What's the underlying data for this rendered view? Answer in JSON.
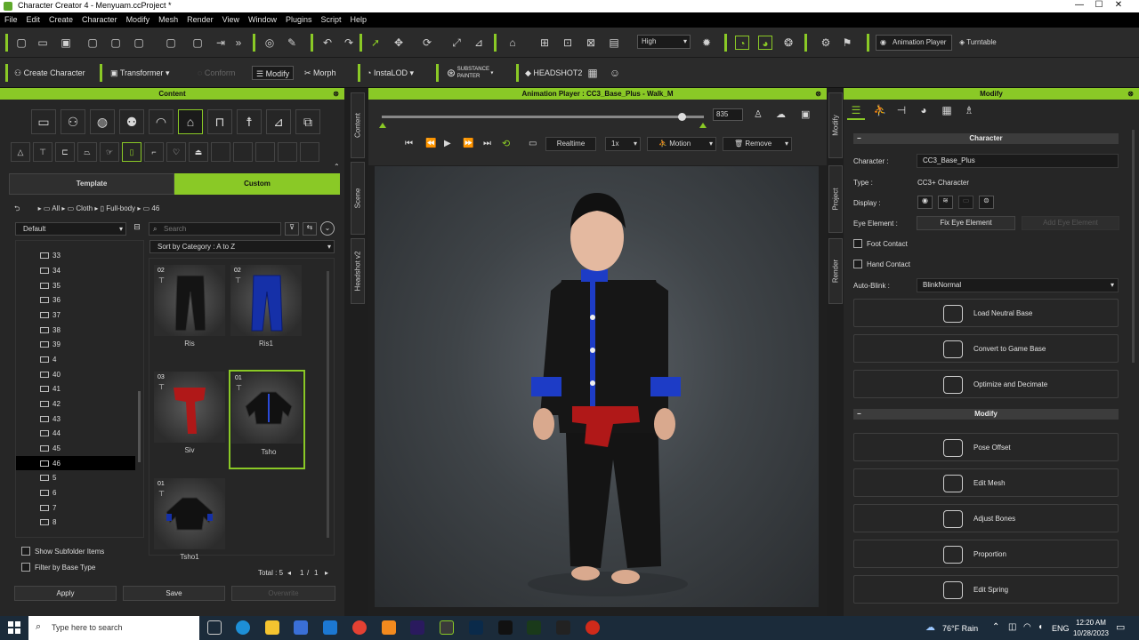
{
  "window": {
    "title": "Character Creator 4 - Menyuam.ccProject *",
    "min": "—",
    "max": "☐",
    "close": "✕"
  },
  "menu": [
    "File",
    "Edit",
    "Create",
    "Character",
    "Modify",
    "Mesh",
    "Render",
    "View",
    "Window",
    "Plugins",
    "Script",
    "Help"
  ],
  "toolbar1": {
    "quality": "High",
    "animation_player": "Animation Player",
    "turntable": "Turntable"
  },
  "toolbar2": {
    "create_character": "Create Character",
    "transformer": "Transformer",
    "conform": "Conform",
    "modify": "Modify",
    "morph": "Morph",
    "instalod": "InstaLOD",
    "substance": "SUBSTANCE PAINTER",
    "headshot": "HEADSHOT2"
  },
  "content": {
    "title": "Content",
    "tabs": {
      "template": "Template",
      "custom": "Custom"
    },
    "breadcrumb": [
      "All",
      "Cloth",
      "Full-body",
      "46"
    ],
    "filter": "Default",
    "search_placeholder": "Search",
    "sort": "Sort by Category : A to Z",
    "tree": [
      "33",
      "34",
      "35",
      "36",
      "37",
      "38",
      "39",
      "4",
      "40",
      "41",
      "42",
      "43",
      "44",
      "45",
      "46",
      "5",
      "6",
      "7",
      "8"
    ],
    "selected_tree": "46",
    "items": [
      {
        "tag": "02",
        "label": "Ris",
        "color": "#1a1a1a"
      },
      {
        "tag": "02",
        "label": "Ris1",
        "color": "#1530a8"
      },
      {
        "tag": "03",
        "label": "Siv",
        "color": "#b01818"
      },
      {
        "tag": "01",
        "label": "Tsho",
        "color": "#111111"
      },
      {
        "tag": "01",
        "label": "Tsho1",
        "color": "#111111"
      }
    ],
    "show_subfolder": "Show Subfolder Items",
    "filter_base": "Filter by Base Type",
    "total": "Total : 5",
    "page": "1",
    "page_sep": "/",
    "page_total": "1",
    "apply": "Apply",
    "save": "Save",
    "overwrite": "Overwrite"
  },
  "side_tabs_left": [
    "Content",
    "Scene",
    "Headshot v2"
  ],
  "side_tabs_right": [
    "Modify",
    "Project",
    "Render"
  ],
  "player": {
    "title": "Animation Player : CC3_Base_Plus - Walk_M",
    "frame": "835",
    "realtime": "Realtime",
    "speed": "1x",
    "motion": "Motion",
    "remove": "Remove",
    "progress": 0.93
  },
  "modify": {
    "title": "Modify",
    "character_section": "Character",
    "character_label": "Character :",
    "character_value": "CC3_Base_Plus",
    "type_label": "Type :",
    "type_value": "CC3+ Character",
    "display_label": "Display :",
    "eye_label": "Eye Element :",
    "fix_eye": "Fix Eye Element",
    "add_eye": "Add Eye Element",
    "foot_contact": "Foot Contact",
    "hand_contact": "Hand Contact",
    "autoblink_label": "Auto-Blink :",
    "autoblink_value": "BlinkNormal",
    "buttons1": [
      "Load Neutral Base",
      "Convert to Game Base",
      "Optimize and Decimate"
    ],
    "modify_section": "Modify",
    "buttons2": [
      "Pose Offset",
      "Edit Mesh",
      "Adjust Bones",
      "Proportion",
      "Edit Spring"
    ]
  },
  "taskbar": {
    "search": "Type here to search",
    "weather": "76°F  Rain",
    "lang": "ENG",
    "time": "12:20 AM",
    "date": "10/28/2023"
  }
}
